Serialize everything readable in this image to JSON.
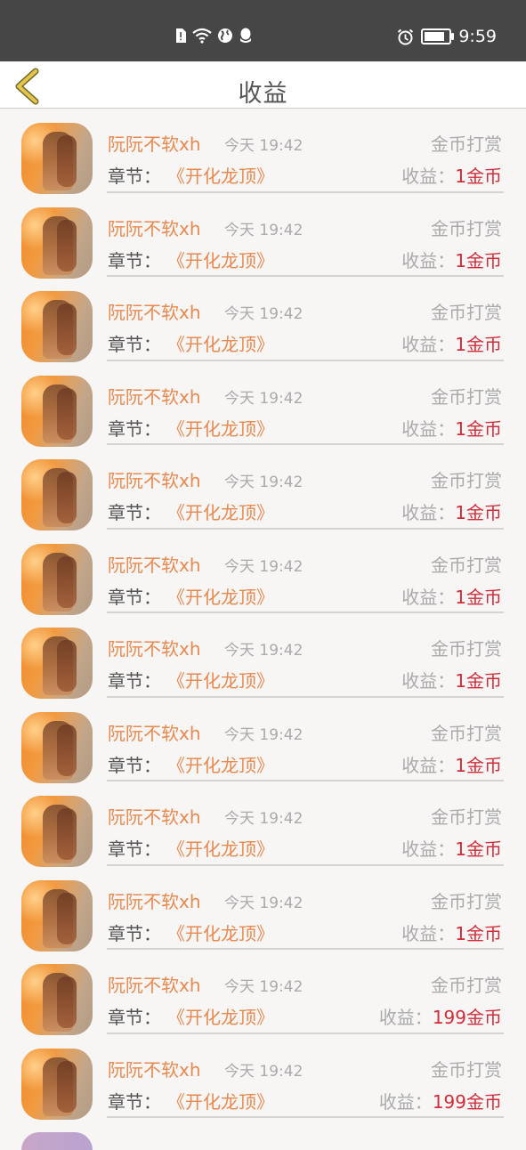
{
  "status_bar": {
    "time": "9:59",
    "icons": [
      "sim-alert-icon",
      "wifi-icon",
      "globe-icon",
      "qq-icon",
      "alarm-icon",
      "battery-icon"
    ]
  },
  "header": {
    "title": "收益",
    "back_icon": "chevron-left-icon"
  },
  "accent_colors": {
    "name": "#e8894f",
    "earnings": "#d22c3a",
    "back": "#e0b43a"
  },
  "records": [
    {
      "user": "阮阮不软xh",
      "time": "今天 19:42",
      "type": "金币打赏",
      "chapter_label": "章节：",
      "chapter": "《开化龙顶》",
      "earn_label": "收益：",
      "earn": "1金币"
    },
    {
      "user": "阮阮不软xh",
      "time": "今天 19:42",
      "type": "金币打赏",
      "chapter_label": "章节：",
      "chapter": "《开化龙顶》",
      "earn_label": "收益：",
      "earn": "1金币"
    },
    {
      "user": "阮阮不软xh",
      "time": "今天 19:42",
      "type": "金币打赏",
      "chapter_label": "章节：",
      "chapter": "《开化龙顶》",
      "earn_label": "收益：",
      "earn": "1金币"
    },
    {
      "user": "阮阮不软xh",
      "time": "今天 19:42",
      "type": "金币打赏",
      "chapter_label": "章节：",
      "chapter": "《开化龙顶》",
      "earn_label": "收益：",
      "earn": "1金币"
    },
    {
      "user": "阮阮不软xh",
      "time": "今天 19:42",
      "type": "金币打赏",
      "chapter_label": "章节：",
      "chapter": "《开化龙顶》",
      "earn_label": "收益：",
      "earn": "1金币"
    },
    {
      "user": "阮阮不软xh",
      "time": "今天 19:42",
      "type": "金币打赏",
      "chapter_label": "章节：",
      "chapter": "《开化龙顶》",
      "earn_label": "收益：",
      "earn": "1金币"
    },
    {
      "user": "阮阮不软xh",
      "time": "今天 19:42",
      "type": "金币打赏",
      "chapter_label": "章节：",
      "chapter": "《开化龙顶》",
      "earn_label": "收益：",
      "earn": "1金币"
    },
    {
      "user": "阮阮不软xh",
      "time": "今天 19:42",
      "type": "金币打赏",
      "chapter_label": "章节：",
      "chapter": "《开化龙顶》",
      "earn_label": "收益：",
      "earn": "1金币"
    },
    {
      "user": "阮阮不软xh",
      "time": "今天 19:42",
      "type": "金币打赏",
      "chapter_label": "章节：",
      "chapter": "《开化龙顶》",
      "earn_label": "收益：",
      "earn": "1金币"
    },
    {
      "user": "阮阮不软xh",
      "time": "今天 19:42",
      "type": "金币打赏",
      "chapter_label": "章节：",
      "chapter": "《开化龙顶》",
      "earn_label": "收益：",
      "earn": "1金币"
    },
    {
      "user": "阮阮不软xh",
      "time": "今天 19:42",
      "type": "金币打赏",
      "chapter_label": "章节：",
      "chapter": "《开化龙顶》",
      "earn_label": "收益：",
      "earn": "199金币"
    },
    {
      "user": "阮阮不软xh",
      "time": "今天 19:42",
      "type": "金币打赏",
      "chapter_label": "章节：",
      "chapter": "《开化龙顶》",
      "earn_label": "收益：",
      "earn": "199金币"
    }
  ]
}
